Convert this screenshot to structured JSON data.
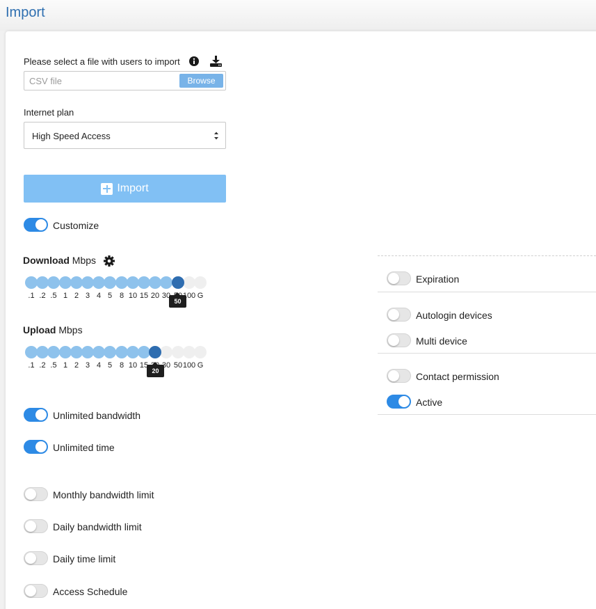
{
  "page": {
    "title": "Import"
  },
  "file": {
    "label": "Please select a file with users to import",
    "placeholder": "CSV file",
    "browse_label": "Browse",
    "info_icon": "info-icon",
    "download_icon": "download-icon"
  },
  "plan": {
    "label": "Internet plan",
    "selected": "High Speed Access"
  },
  "import_button": {
    "label": "Import",
    "icon": "plus-square-icon"
  },
  "customize": {
    "label": "Customize",
    "on": true
  },
  "download": {
    "title_bold": "Download",
    "title_unit": "Mbps",
    "settings_icon": "gear-icon",
    "ticks": [
      ".1",
      ".2",
      ".5",
      "1",
      "2",
      "3",
      "4",
      "5",
      "8",
      "10",
      "15",
      "20",
      "30",
      "50",
      "100",
      "G"
    ],
    "selected_index": 13,
    "value": "50"
  },
  "upload": {
    "title_bold": "Upload",
    "title_unit": "Mbps",
    "ticks": [
      ".1",
      ".2",
      ".5",
      "1",
      "2",
      "3",
      "4",
      "5",
      "8",
      "10",
      "15",
      "20",
      "30",
      "50",
      "100",
      "G"
    ],
    "selected_index": 11,
    "value": "20"
  },
  "toggles_left": [
    {
      "label": "Unlimited bandwidth",
      "on": true
    },
    {
      "label": "Unlimited time",
      "on": true
    },
    {
      "label": "Monthly bandwidth limit",
      "on": false
    },
    {
      "label": "Daily bandwidth limit",
      "on": false
    },
    {
      "label": "Daily time limit",
      "on": false
    },
    {
      "label": "Access Schedule",
      "on": false
    }
  ],
  "toggles_right": [
    {
      "label": "Expiration",
      "on": false
    },
    {
      "label": "Autologin devices",
      "on": false
    },
    {
      "label": "Multi device",
      "on": false
    },
    {
      "label": "Contact permission",
      "on": false
    },
    {
      "label": "Active",
      "on": true
    }
  ],
  "colors": {
    "accent": "#2d8ae5",
    "title": "#2f6fb0",
    "slider_active": "#8ec2ec",
    "slider_handle": "#2e6db0",
    "import_button": "#81c0f4"
  }
}
